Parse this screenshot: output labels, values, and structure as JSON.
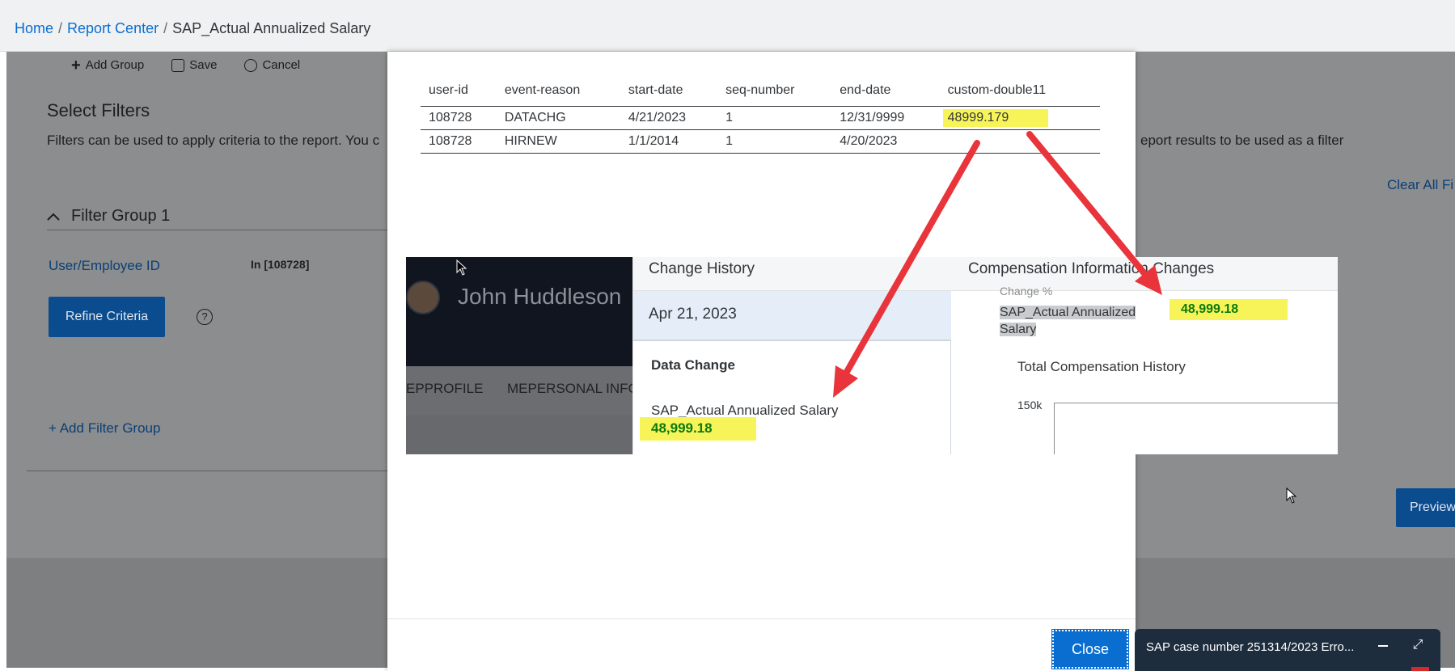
{
  "breadcrumb": {
    "home": "Home",
    "report_center": "Report Center",
    "current": "SAP_Actual Annualized Salary",
    "separator": "/"
  },
  "toolbar": {
    "add_group": "Add Group",
    "save": "Save",
    "cancel": "Cancel"
  },
  "filters": {
    "title": "Select Filters",
    "description_left": "Filters can be used to apply criteria to the report. You c",
    "description_right": "eport results to be used as a filter",
    "clear_all": "Clear All Fi",
    "group_title": "Filter Group 1",
    "user_id_label": "User/Employee ID",
    "user_id_value": "In [108728]",
    "refine_button": "Refine Criteria",
    "help_icon": "?",
    "add_filter_group": "Add Filter Group",
    "preview_button": "Preview"
  },
  "table": {
    "columns": [
      "user-id",
      "event-reason",
      "start-date",
      "seq-number",
      "end-date",
      "custom-double11"
    ],
    "rows": [
      [
        "108728",
        "DATACHG",
        "4/21/2023",
        "1",
        "12/31/9999",
        "48999.179"
      ],
      [
        "108728",
        "HIRNEW",
        "1/1/2014",
        "1",
        "4/20/2023",
        ""
      ]
    ]
  },
  "pasted": {
    "employee_name": "John Huddleson",
    "nav_item_1": "EPPROFILE",
    "nav_item_2": "MEPERSONAL INFO",
    "change_history_title": "Change History",
    "change_date": "Apr 21, 2023",
    "data_change_label": "Data Change",
    "salary_label": "SAP_Actual Annualized Salary",
    "salary_value": "48,999.18",
    "comp_changes_title": "Compensation Information Changes",
    "comp_cut_text": "Change %",
    "comp_salary_label": "SAP_Actual Annualized Salary",
    "comp_salary_value": "48,999.18",
    "total_comp_history": "Total Compensation History",
    "axis_label": "150k"
  },
  "dialog": {
    "close_button": "Close"
  },
  "notification": {
    "text": "SAP case number 251314/2023 Erro..."
  },
  "colors": {
    "highlight": "#f7f45a",
    "value_green": "#0c7a0c",
    "arrow_red": "#e8343a",
    "sap_blue": "#0a6ed1"
  }
}
